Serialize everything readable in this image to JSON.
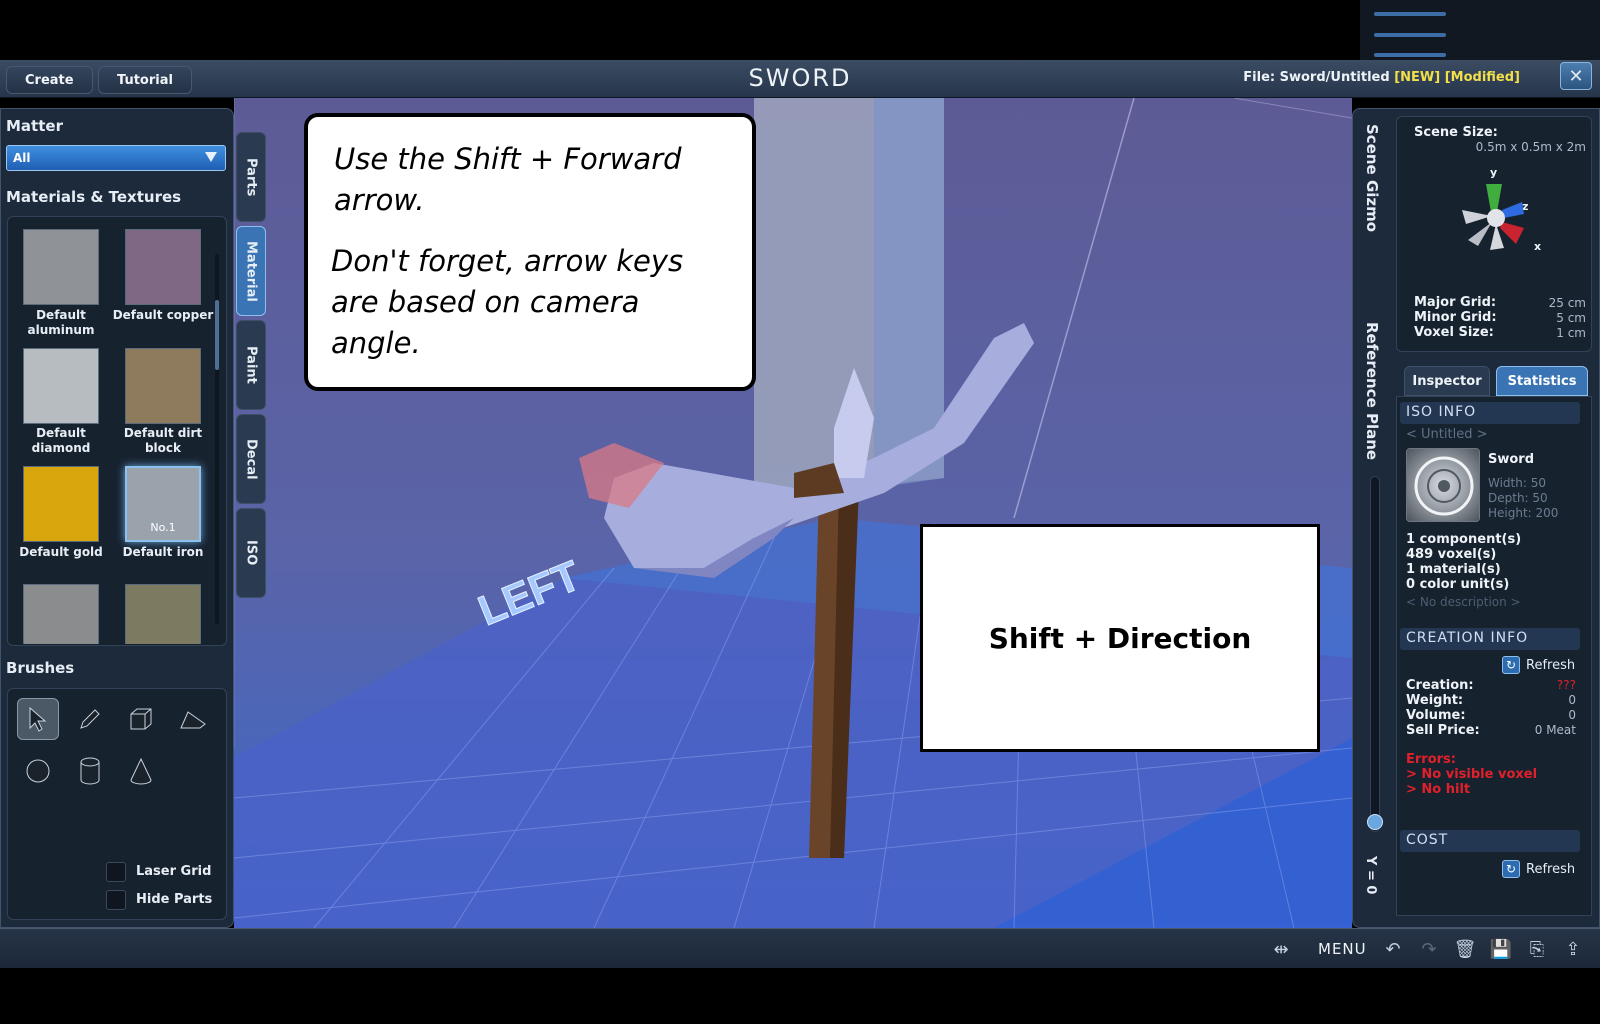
{
  "header": {
    "create_tab": "Create",
    "tutorial_tab": "Tutorial",
    "app_title": "SWORD",
    "file_prefix": "File:",
    "file_path": "Sword/Untitled",
    "flag_new": "[NEW]",
    "flag_modified": "[Modified]"
  },
  "left_panel": {
    "matter_heading": "Matter",
    "matter_selected": "All",
    "materials_heading": "Materials & Textures",
    "materials": [
      {
        "label": "Default aluminum",
        "color": "#8f9397"
      },
      {
        "label": "Default copper",
        "color": "#7e6883"
      },
      {
        "label": "Default diamond",
        "color": "#b7bcc1"
      },
      {
        "label": "Default dirt block",
        "color": "#8e7a5c"
      },
      {
        "label": "Default gold",
        "color": "#d9a60e"
      },
      {
        "label": "Default iron",
        "color": "#9aa2ab",
        "badge": "No.1"
      }
    ],
    "brushes_heading": "Brushes",
    "laser_grid": "Laser Grid",
    "hide_parts": "Hide Parts"
  },
  "side_tabs": [
    "Parts",
    "Material",
    "Paint",
    "Decal",
    "ISO"
  ],
  "scene": {
    "left_label": "LEFT"
  },
  "right_panel": {
    "scene_gizmo": "Scene Gizmo",
    "reference_plane": "Reference Plane",
    "y_readout": "Y = 0",
    "scene_size_label": "Scene Size:",
    "scene_size_value": "0.5m x 0.5m x 2m",
    "axes": {
      "y": "y",
      "z": "z",
      "x": "x"
    },
    "major_grid_label": "Major Grid:",
    "major_grid_value": "25 cm",
    "minor_grid_label": "Minor Grid:",
    "minor_grid_value": "5 cm",
    "voxel_size_label": "Voxel Size:",
    "voxel_size_value": "1 cm",
    "tab_inspector": "Inspector",
    "tab_statistics": "Statistics",
    "iso_info_heading": "ISO INFO",
    "iso_untitled": "< Untitled >",
    "iso_name": "Sword",
    "iso_width": "Width: 50",
    "iso_depth": "Depth: 50",
    "iso_height": "Height: 200",
    "components": "1 component(s)",
    "voxels": "489 voxel(s)",
    "materials": "1 material(s)",
    "color_units": "0 color unit(s)",
    "no_description": "< No description >",
    "creation_heading": "CREATION INFO",
    "refresh": "Refresh",
    "creation_label": "Creation:",
    "creation_value": "???",
    "weight_label": "Weight:",
    "weight_value": "0",
    "volume_label": "Volume:",
    "volume_value": "0",
    "sell_label": "Sell Price:",
    "sell_value": "0 Meat",
    "errors_label": "Errors:",
    "error_1": "> No visible voxel",
    "error_2": "> No hilt",
    "cost_heading": "COST",
    "cost_refresh": "Refresh"
  },
  "bottom_bar": {
    "menu": "MENU"
  },
  "callouts": {
    "line_1": "Use the Shift + Forward",
    "line_2": "arrow.",
    "line_3": "Don't forget, arrow keys",
    "line_4": "are based on camera",
    "line_5": "angle.",
    "shortcut": "Shift + Direction"
  },
  "colors": {
    "accent": "#3a74b4",
    "warning": "#f2e04a",
    "error": "#ff2a2a"
  }
}
